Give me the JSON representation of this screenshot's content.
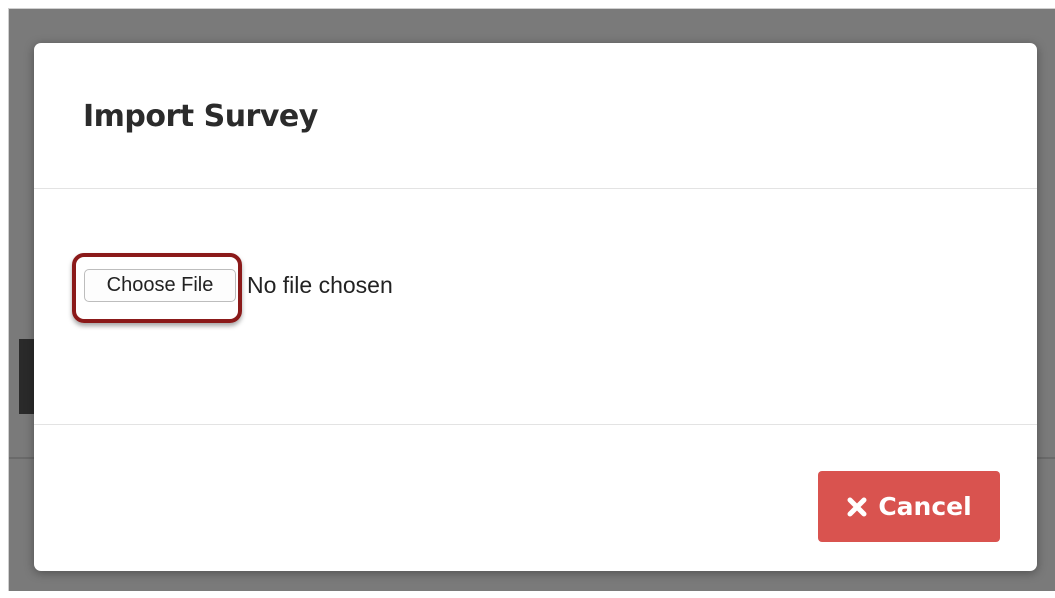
{
  "dialog": {
    "title": "Import Survey"
  },
  "file_input": {
    "button_label": "Choose File",
    "status_text": "No file chosen"
  },
  "footer": {
    "cancel_label": "Cancel",
    "cancel_icon": "close-icon"
  },
  "colors": {
    "cancel_button": "#d9534f",
    "highlight_border": "#8b1a1a",
    "backdrop": "#7a7a7a"
  }
}
